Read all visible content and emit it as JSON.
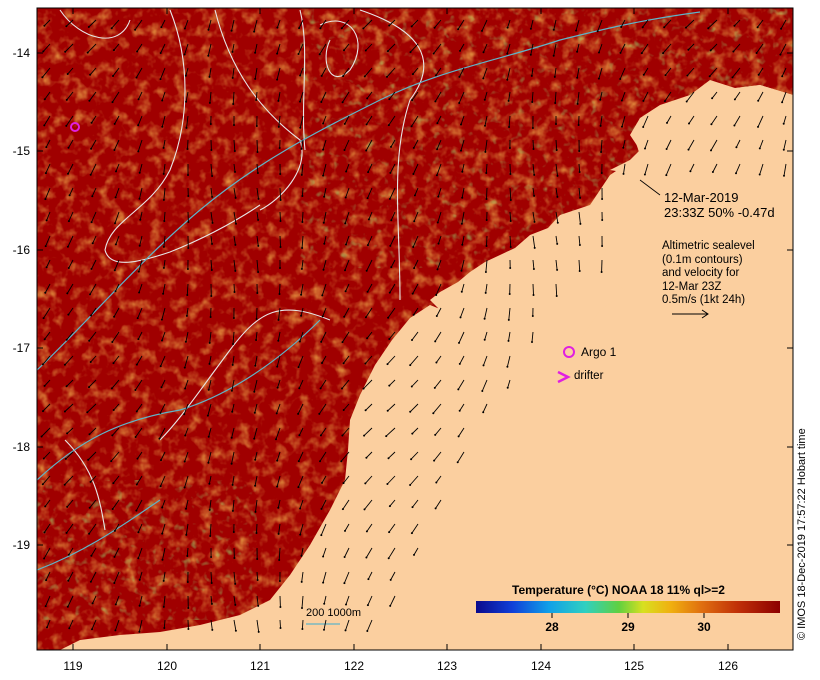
{
  "map": {
    "lat_ticks": [
      "-14",
      "-15",
      "-16",
      "-17",
      "-18",
      "-19"
    ],
    "lon_ticks": [
      "119",
      "120",
      "121",
      "122",
      "123",
      "124",
      "125",
      "126"
    ],
    "colors": {
      "land": "#fbcf9f",
      "sst_background": "#a00000",
      "contour": "#e6e6e6",
      "sea_current": "#5fb4c8",
      "marker": "#e020e0"
    }
  },
  "annotations": {
    "date_line1": "12-Mar-2019",
    "date_line2": "23:33Z  50% -0.47d",
    "altimetric": [
      "Altimetric sealevel",
      "(0.1m contours)",
      "and velocity for",
      "12-Mar 23Z",
      "0.5m/s (1kt 24h)"
    ],
    "argo_label": "Argo 1",
    "drifter_label": "drifter",
    "scale_label": "200  1000m"
  },
  "colorbar": {
    "title": "Temperature (°C) NOAA 18 11% ql>=2",
    "ticks": [
      "28",
      "29",
      "30"
    ],
    "range": [
      27.0,
      31.0
    ],
    "tick_values": [
      28,
      29,
      30
    ]
  },
  "credit": "© IMOS 18-Dec-2019 17:57:22 Hobart time"
}
